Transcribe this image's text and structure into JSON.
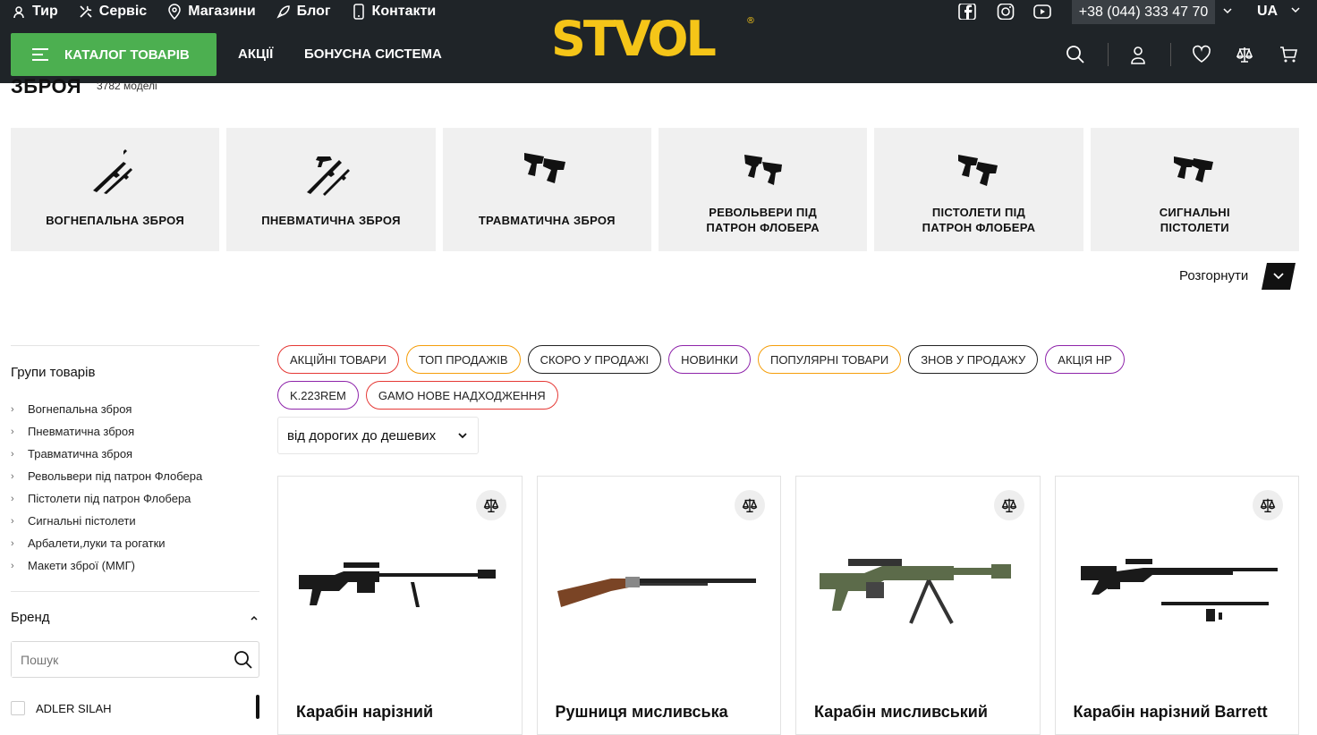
{
  "topnav": [
    {
      "label": "Тир",
      "icon": "target-icon"
    },
    {
      "label": "Сервіс",
      "icon": "tools-icon"
    },
    {
      "label": "Магазини",
      "icon": "location-pin-icon"
    },
    {
      "label": "Блог",
      "icon": "rocket-icon"
    },
    {
      "label": "Контакти",
      "icon": "phone-icon"
    }
  ],
  "catalog_label": "КАТАЛОГ ТОВАРІВ",
  "mainnav": [
    "АКЦІЇ",
    "БОНУСНА СИСТЕМА"
  ],
  "logo": "STVOL",
  "phone": "+38 (044) 333 47 70",
  "lang": "UA",
  "page": {
    "title": "ЗБРОЯ",
    "count": "3782 моделі"
  },
  "categories": [
    "ВОГНЕПАЛЬНА ЗБРОЯ",
    "ПНЕВМАТИЧНА ЗБРОЯ",
    "ТРАВМАТИЧНА ЗБРОЯ",
    "РЕВОЛЬВЕРИ ПІД ПАТРОН ФЛОБЕРА",
    "ПІСТОЛЕТИ ПІД ПАТРОН ФЛОБЕРА",
    "СИГНАЛЬНІ ПІСТОЛЕТИ"
  ],
  "expand_label": "Розгорнути",
  "sidebar": {
    "groups_title": "Групи товарів",
    "groups": [
      "Вогнепальна зброя",
      "Пневматична зброя",
      "Травматична зброя",
      "Револьвери під патрон Флобера",
      "Пістолети під патрон Флобера",
      "Сигнальні пістолети",
      "Арбалети,луки та рогатки",
      "Макети зброї (ММГ)"
    ],
    "brand_title": "Бренд",
    "brand_search_placeholder": "Пошук",
    "brands": [
      "ADLER SILAH"
    ]
  },
  "tags": [
    {
      "label": "АКЦІЙНІ ТОВАРИ",
      "color": "#e53935"
    },
    {
      "label": "ТОП ПРОДАЖІВ",
      "color": "#f59e0b"
    },
    {
      "label": "СКОРО У ПРОДАЖІ",
      "color": "#222222"
    },
    {
      "label": "НОВИНКИ",
      "color": "#8e24aa"
    },
    {
      "label": "ПОПУЛЯРНІ ТОВАРИ",
      "color": "#f59e0b"
    },
    {
      "label": "ЗНОВ У ПРОДАЖУ",
      "color": "#222222"
    },
    {
      "label": "АКЦІЯ НР",
      "color": "#8e24aa"
    },
    {
      "label": "K.223REM",
      "color": "#8e24aa"
    },
    {
      "label": "GAMO НОВЕ НАДХОДЖЕННЯ",
      "color": "#e53935"
    }
  ],
  "sort_label": "від дорогих до дешевих",
  "products": [
    "Карабін нарізний",
    "Рушниця мисливська",
    "Карабін мисливський",
    "Карабін нарізний Barrett"
  ],
  "colors": {
    "header_bg": "#1f2428",
    "accent_green": "#4caf50",
    "logo_yellow": "#f5c518"
  }
}
